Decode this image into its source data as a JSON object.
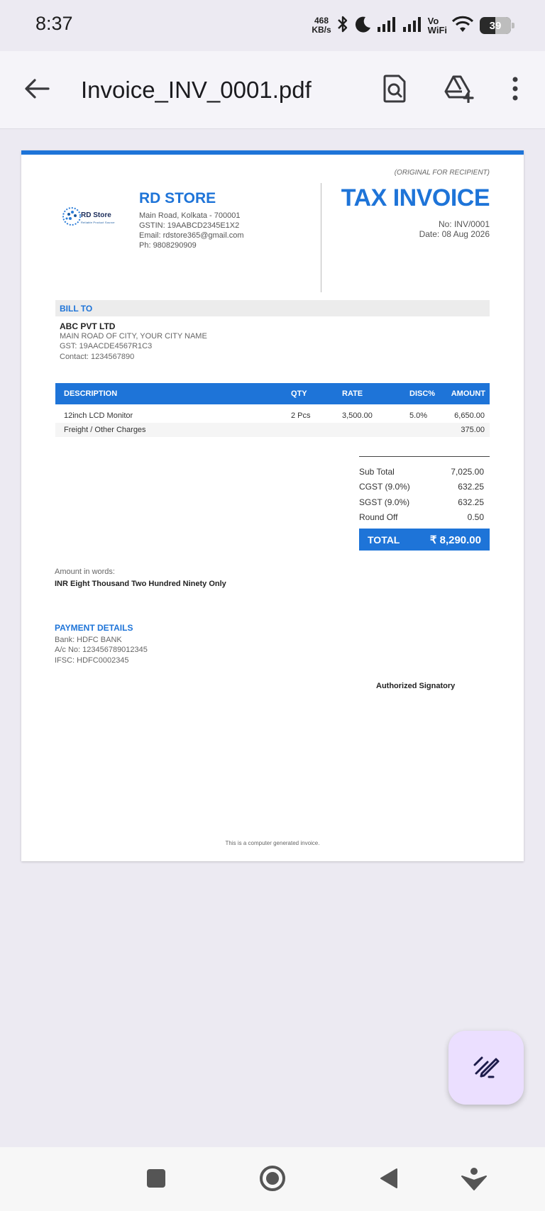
{
  "status_bar": {
    "time": "8:37",
    "net_speed_value": "468",
    "net_speed_unit": "KB/s",
    "vowifi_top": "Vo",
    "vowifi_bottom": "WiFi",
    "battery": "39",
    "icons": [
      "bluetooth-icon",
      "dnd-moon-icon",
      "signal-icon",
      "signal-icon",
      "wifi-icon",
      "battery-icon"
    ]
  },
  "app_bar": {
    "title": "Invoice_INV_0001.pdf",
    "icons": [
      "back-arrow-icon",
      "find-in-document-icon",
      "add-to-drive-icon",
      "more-vert-icon"
    ]
  },
  "invoice": {
    "original_note": "(ORIGINAL FOR RECIPIENT)",
    "logo": {
      "text": "RD Store",
      "tagline": "Reliable Product Source"
    },
    "store": {
      "name": "RD STORE",
      "address": "Main Road, Kolkata - 700001",
      "gstin": "GSTIN: 19AABCD2345E1X2",
      "email": "Email: rdstore365@gmail.com",
      "phone": "Ph: 9808290909"
    },
    "title": "TAX INVOICE",
    "number": "No: INV/0001",
    "date": "Date: 08 Aug 2026",
    "bill_to": {
      "label": "BILL TO",
      "name": "ABC PVT LTD",
      "address": "MAIN ROAD OF CITY, YOUR CITY NAME",
      "gst": "GST: 19AACDE4567R1C3",
      "contact": "Contact: 1234567890"
    },
    "columns": [
      "DESCRIPTION",
      "QTY",
      "RATE",
      "DISC%",
      "AMOUNT"
    ],
    "items": [
      {
        "description": "12inch LCD Monitor",
        "qty": "2 Pcs",
        "rate": "3,500.00",
        "disc": "5.0%",
        "amount": "6,650.00"
      },
      {
        "description": "Freight / Other Charges",
        "qty": "",
        "rate": "",
        "disc": "",
        "amount": "375.00"
      }
    ],
    "summary": [
      {
        "label": "Sub Total",
        "value": "7,025.00"
      },
      {
        "label": "CGST (9.0%)",
        "value": "632.25"
      },
      {
        "label": "SGST (9.0%)",
        "value": "632.25"
      },
      {
        "label": "Round Off",
        "value": "0.50"
      }
    ],
    "total_label": "TOTAL",
    "total_value": "₹ 8,290.00",
    "amount_words_label": "Amount in words:",
    "amount_words": "INR Eight Thousand Two Hundred Ninety Only",
    "payment": {
      "title": "PAYMENT DETAILS",
      "bank": "Bank: HDFC BANK",
      "account": "A/c No: 123456789012345",
      "ifsc": "IFSC: HDFC0002345"
    },
    "signatory": "Authorized Signatory",
    "footer": "This is a computer generated invoice."
  },
  "fab": {
    "icon": "signature-pen-icon"
  },
  "nav_bar": {
    "icons": [
      "recents-square-icon",
      "home-circle-icon",
      "back-triangle-icon",
      "assistant-icon"
    ]
  },
  "colors": {
    "accent": "#1e74d8",
    "fab_bg": "#ebdfff",
    "app_bg": "#eceaf2"
  }
}
